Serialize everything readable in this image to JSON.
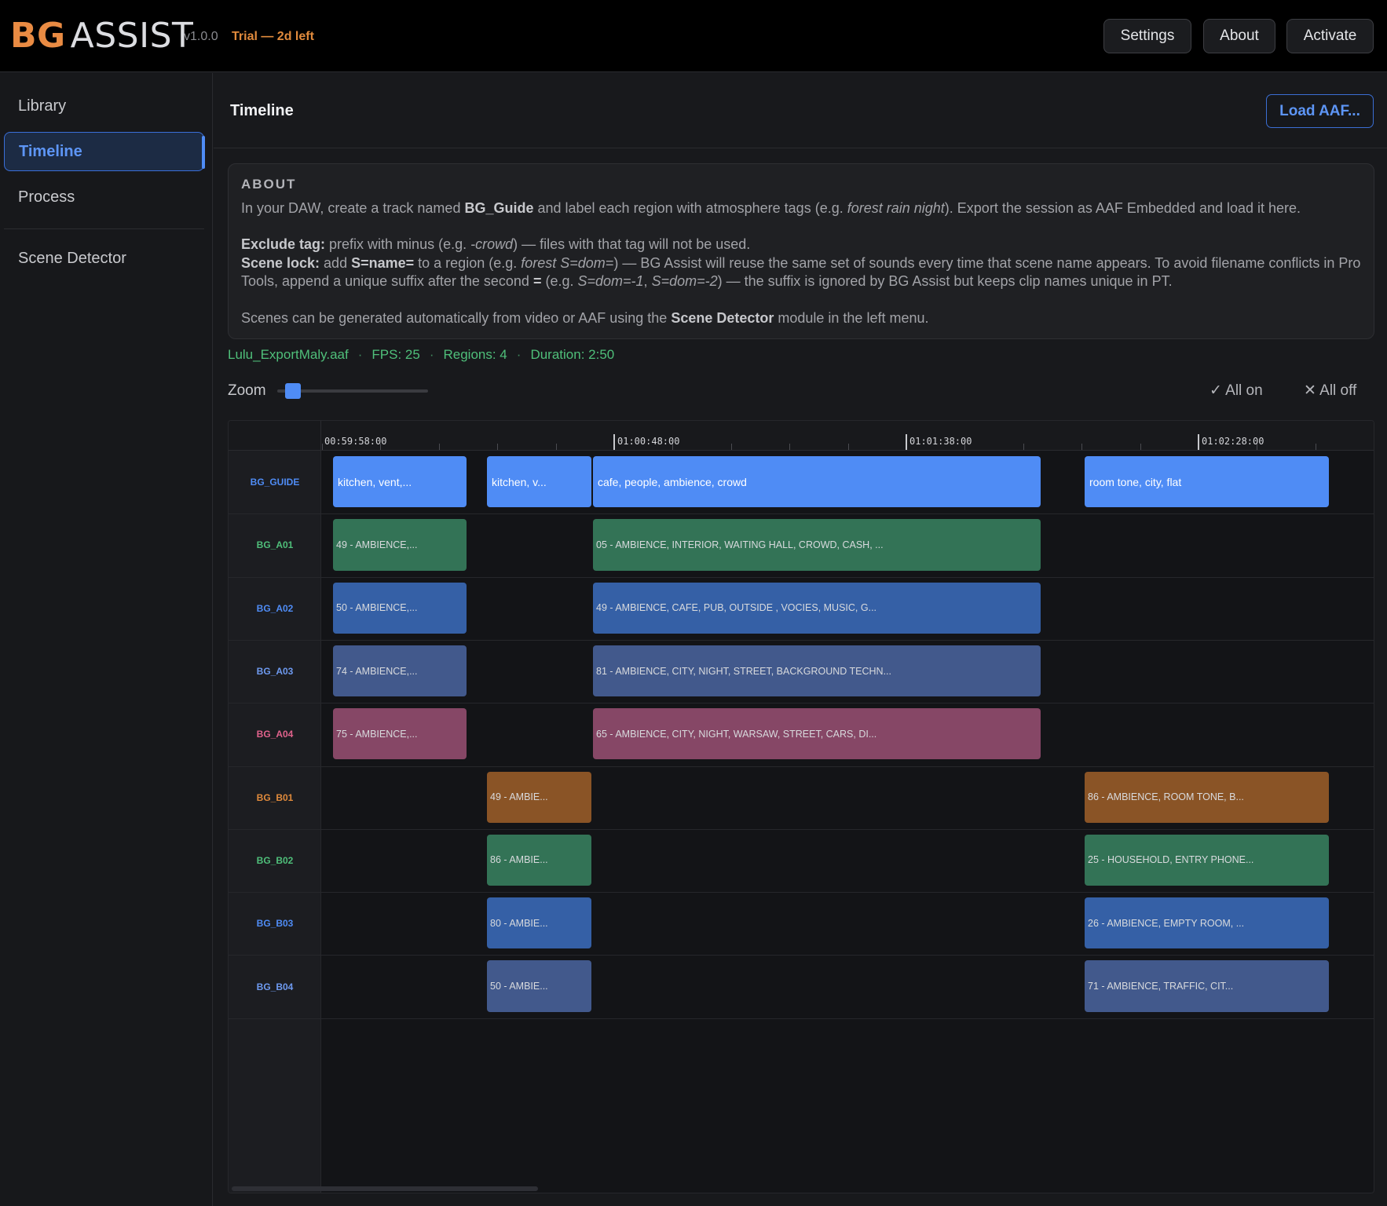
{
  "header": {
    "brand_bg": "BG",
    "brand_assist": "ASSIST",
    "version": "v1.0.0",
    "trial": "Trial — 2d left",
    "buttons": {
      "settings": "Settings",
      "about": "About",
      "activate": "Activate"
    }
  },
  "sidebar": {
    "items": [
      {
        "label": "Library",
        "active": false
      },
      {
        "label": "Timeline",
        "active": true
      },
      {
        "label": "Process",
        "active": false
      },
      {
        "label": "Scene Detector",
        "active": false
      }
    ]
  },
  "main": {
    "title": "Timeline",
    "load_button": "Load AAF..."
  },
  "about": {
    "heading": "ABOUT",
    "p1_a": "In your DAW, create a track named ",
    "p1_b": "BG_Guide",
    "p1_c": " and label each region with atmosphere tags (e.g. ",
    "p1_d": "forest rain night",
    "p1_e": "). Export the session as AAF Embedded and load it here.",
    "p2_a": "Exclude tag:",
    "p2_b": " prefix with minus (e.g. ",
    "p2_c": "-crowd",
    "p2_d": ") — files with that tag will not be used.",
    "p3_a": "Scene lock:",
    "p3_b": " add ",
    "p3_c": "S=name=",
    "p3_d": " to a region (e.g. ",
    "p3_e": "forest S=dom=",
    "p3_f": ") — BG Assist will reuse the same set of sounds every time that scene name appears. To avoid filename conflicts in Pro Tools, append a unique suffix after the second ",
    "p3_g": "=",
    "p3_h": " (e.g. ",
    "p3_i": "S=dom=-1",
    "p3_j": ", ",
    "p3_k": "S=dom=-2",
    "p3_l": ") — the suffix is ignored by BG Assist but keeps clip names unique in PT.",
    "p4_a": "Scenes can be generated automatically from video or AAF using the ",
    "p4_b": "Scene Detector",
    "p4_c": " module in the left menu."
  },
  "fileinfo": {
    "file": "Lulu_ExportMaly.aaf",
    "fps": "FPS: 25",
    "regions": "Regions: 4",
    "duration": "Duration: 2:50",
    "color": "#4fbf7a"
  },
  "zoom": {
    "label": "Zoom",
    "level": 0.05
  },
  "toggles": {
    "all_on": "✓ All on",
    "all_off": "✕ All off"
  },
  "timeline": {
    "ruler_labels": [
      "00:59:58:00",
      "01:00:48:00",
      "01:01:38:00",
      "01:02:28:00"
    ],
    "tracks": [
      {
        "name": "BG_GUIDE",
        "color": "#4f8cf5",
        "clips": [
          "kitchen, vent,...",
          "kitchen, v...",
          "cafe, people, ambience, crowd",
          "room tone, city, flat"
        ]
      },
      {
        "name": "BG_A01",
        "color": "#4fbf7a",
        "clips": [
          "49 - AMBIENCE,...",
          "05 - AMBIENCE, INTERIOR, WAITING HALL, CROWD, CASH, ..."
        ]
      },
      {
        "name": "BG_A02",
        "color": "#4f8cf5",
        "clips": [
          "50 - AMBIENCE,...",
          "49 - AMBIENCE, CAFE, PUB, OUTSIDE , VOCIES, MUSIC, G..."
        ]
      },
      {
        "name": "BG_A03",
        "color": "#6e9af0",
        "clips": [
          "74 - AMBIENCE,...",
          "81 - AMBIENCE, CITY, NIGHT, STREET, BACKGROUND TECHN..."
        ]
      },
      {
        "name": "BG_A04",
        "color": "#e0628c",
        "clips": [
          "75 - AMBIENCE,...",
          "65 - AMBIENCE, CITY, NIGHT, WARSAW, STREET, CARS, DI..."
        ]
      },
      {
        "name": "BG_B01",
        "color": "#e08a3c",
        "clips": [
          "49 - AMBIE...",
          "86 - AMBIENCE, ROOM TONE, B..."
        ]
      },
      {
        "name": "BG_B02",
        "color": "#4fbf7a",
        "clips": [
          "86 - AMBIE...",
          "25 - HOUSEHOLD, ENTRY PHONE..."
        ]
      },
      {
        "name": "BG_B03",
        "color": "#4f8cf5",
        "clips": [
          "80 - AMBIE...",
          "26 - AMBIENCE, EMPTY ROOM, ..."
        ]
      },
      {
        "name": "BG_B04",
        "color": "#6e9af0",
        "clips": [
          "50 - AMBIE...",
          "71 - AMBIENCE, TRAFFIC, CIT..."
        ]
      }
    ],
    "clip_colors": {
      "guide": "#4f8cf5",
      "green": "#337356",
      "blue": "#3560a6",
      "slate": "#42598c",
      "pink": "#864766",
      "orange": "#8a5426"
    }
  }
}
